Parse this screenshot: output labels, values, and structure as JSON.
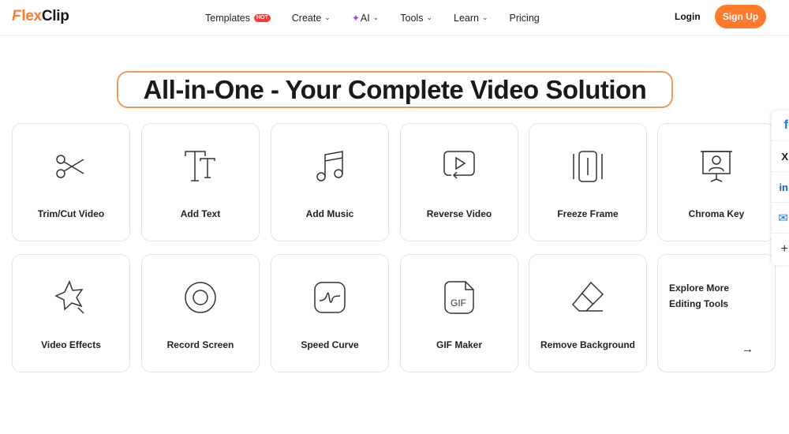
{
  "header": {
    "logo_mark": "F",
    "logo_text_a": "lex",
    "logo_text_b": "Clip",
    "nav": [
      {
        "label": "Templates",
        "badge": "HOT"
      },
      {
        "label": "Create"
      },
      {
        "label": "AI"
      },
      {
        "label": "Tools"
      },
      {
        "label": "Learn"
      },
      {
        "label": "Pricing"
      }
    ],
    "login": "Login",
    "signup": "Sign Up"
  },
  "headline": "All-in-One - Your Complete Video Solution",
  "tools": [
    {
      "label": "Trim/Cut Video",
      "icon": "scissors-icon"
    },
    {
      "label": "Add Text",
      "icon": "text-icon"
    },
    {
      "label": "Add Music",
      "icon": "music-note-icon"
    },
    {
      "label": "Reverse Video",
      "icon": "reverse-play-icon"
    },
    {
      "label": "Freeze Frame",
      "icon": "freeze-frame-icon"
    },
    {
      "label": "Chroma Key",
      "icon": "presenter-screen-icon"
    },
    {
      "label": "Video Effects",
      "icon": "star-wand-icon"
    },
    {
      "label": "Record Screen",
      "icon": "record-icon"
    },
    {
      "label": "Speed Curve",
      "icon": "speed-curve-icon"
    },
    {
      "label": "GIF Maker",
      "icon": "gif-file-icon"
    },
    {
      "label": "Remove Background",
      "icon": "eraser-icon"
    }
  ],
  "explore_more": {
    "line1": "Explore More",
    "line2": "Editing Tools",
    "arrow": "→"
  },
  "share": [
    {
      "name": "facebook",
      "glyph": "f",
      "color": "#1877f2"
    },
    {
      "name": "x",
      "glyph": "X",
      "color": "#111111"
    },
    {
      "name": "linkedin",
      "glyph": "in",
      "color": "#0a66c2"
    },
    {
      "name": "email",
      "glyph": "✉",
      "color": "#1877f2"
    },
    {
      "name": "more",
      "glyph": "+",
      "color": "#333333"
    }
  ],
  "colors": {
    "accent": "#ff7a2b",
    "hot": "#f33c3c",
    "headline_border": "#ee9a5e"
  }
}
